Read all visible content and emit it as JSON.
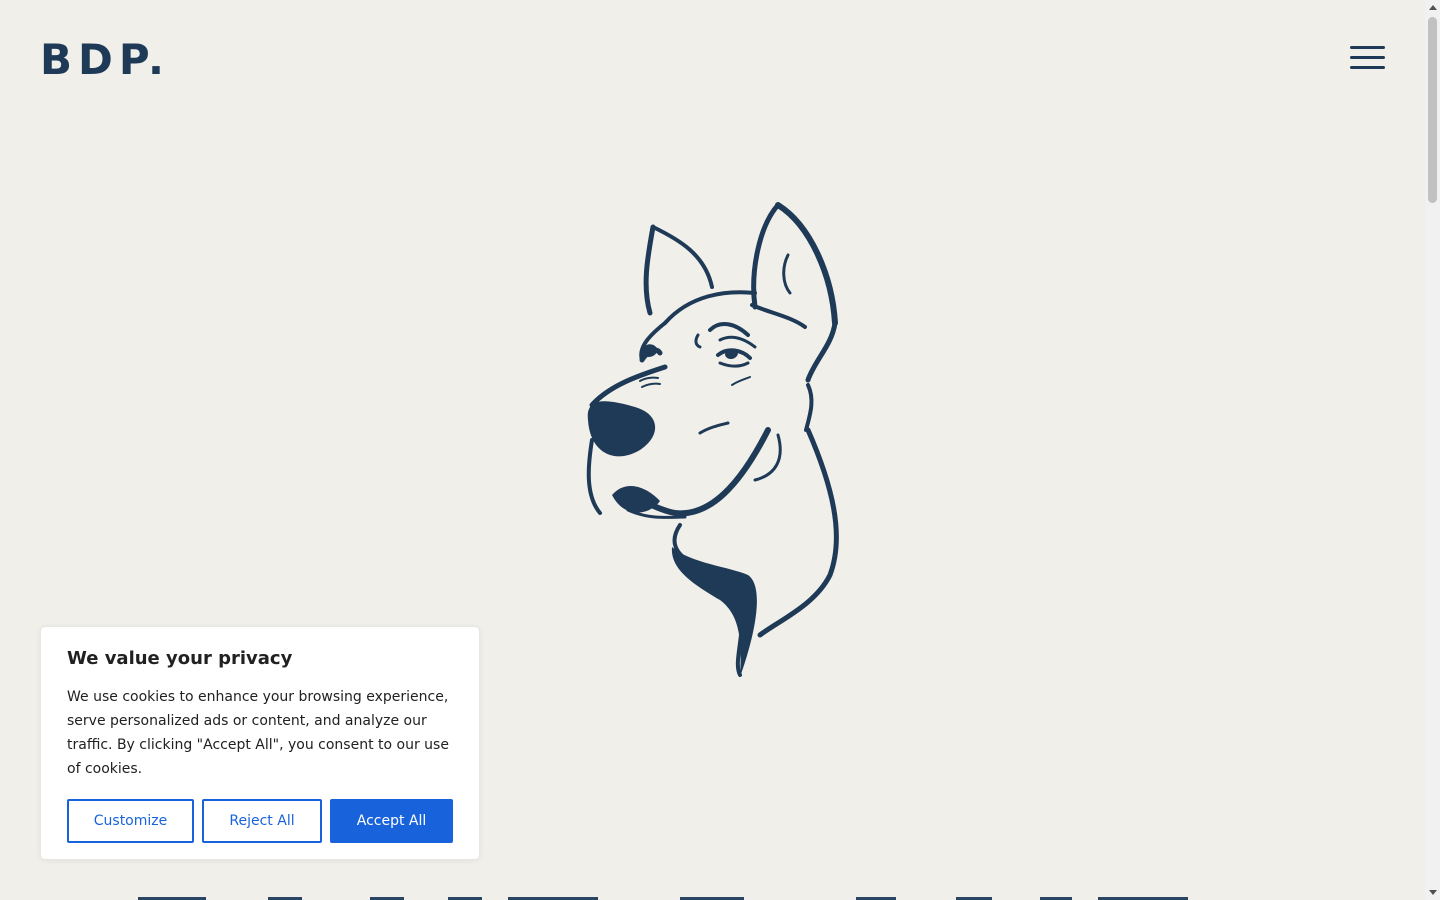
{
  "header": {
    "logo_text": "BDP.",
    "brand_color": "#1f3a57"
  },
  "hero": {
    "illustration": "great-dane-head-line-art"
  },
  "cookie_banner": {
    "title": "We value your privacy",
    "body": "We use cookies to enhance your browsing experience, serve personalized ads or content, and analyze our traffic. By clicking \"Accept All\", you consent to our use of cookies.",
    "customize_label": "Customize",
    "reject_label": "Reject All",
    "accept_label": "Accept All",
    "accent_color": "#1863dc"
  },
  "icons": {
    "menu": "hamburger-menu-icon"
  }
}
